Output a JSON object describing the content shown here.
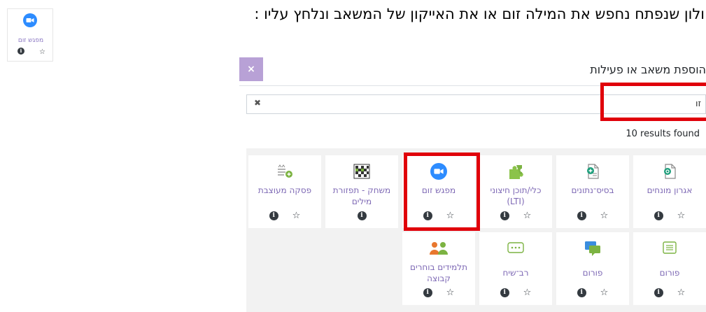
{
  "instruction": "ולון שנפתח נחפש את המילה זום או את האייקון של המשאב ונלחץ עליו :",
  "mini_tile": {
    "label": "מפגש זום",
    "icon": "zoom-camera-icon"
  },
  "modal": {
    "close_symbol": "×",
    "title": "הוספת משאב או פעילות"
  },
  "search": {
    "value": "זו",
    "clear_symbol": "✖"
  },
  "results": {
    "text": "10 results found"
  },
  "tiles": [
    {
      "label": "אגרון מונחים",
      "icon": "glossary-icon",
      "has_star": true
    },
    {
      "label": "בסיס־נתונים",
      "icon": "database-icon",
      "has_star": true
    },
    {
      "label": "כלי/תוכן חיצוני (LTI)",
      "icon": "puzzle-icon",
      "has_star": true
    },
    {
      "label": "מפגש זום",
      "icon": "zoom-camera-icon",
      "has_star": true
    },
    {
      "label": "משחק - תפזורת מילים",
      "icon": "wordsearch-grid-icon",
      "has_star": false
    },
    {
      "label": "פסקה מעוצבת",
      "icon": "label-icon",
      "has_star": true
    },
    {
      "label": "פורום",
      "icon": "forum-icon",
      "has_star": true
    },
    {
      "label": "פורום",
      "icon": "forum-chat-icon",
      "has_star": true
    },
    {
      "label": "רב־שיח",
      "icon": "chat-icon",
      "has_star": true
    },
    {
      "label": "תלמידים בוחרים קבוצה",
      "icon": "group-choice-icon",
      "has_star": true
    }
  ],
  "info_symbol": "i",
  "star_symbol": "☆",
  "colors": {
    "accent": "#b8a1d6",
    "link": "#7e69b5",
    "highlight": "#e0000a",
    "zoom_blue": "#2d8cff"
  }
}
